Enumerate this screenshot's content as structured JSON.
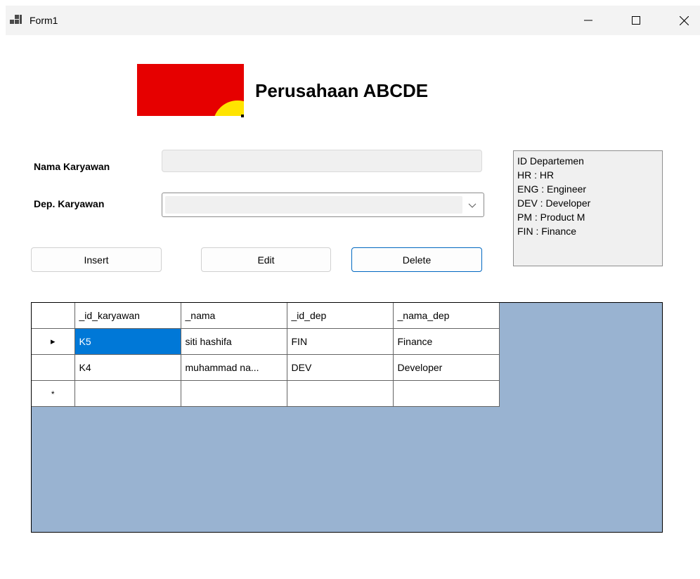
{
  "window": {
    "title": "Form1",
    "minimize_icon": "minimize-icon",
    "maximize_icon": "maximize-icon",
    "close_icon": "close-icon"
  },
  "header": {
    "logo": "company-logo",
    "company_name": "Perusahaan ABCDE"
  },
  "form": {
    "nama_label": "Nama Karyawan",
    "nama_value": "",
    "dep_label": "Dep. Karyawan",
    "dep_value": ""
  },
  "dept_info": {
    "lines": [
      "ID Departemen",
      "HR : HR",
      "ENG : Engineer",
      "DEV : Developer",
      "PM : Product M",
      "FIN : Finance"
    ]
  },
  "buttons": {
    "insert": "Insert",
    "edit": "Edit",
    "delete": "Delete"
  },
  "grid": {
    "columns": [
      "_id_karyawan",
      "_nama",
      "_id_dep",
      "_nama_dep"
    ],
    "rows": [
      {
        "marker": "▸",
        "cells": [
          "K5",
          "siti hashifa",
          "FIN",
          "Finance"
        ],
        "selected_col": 0
      },
      {
        "marker": "",
        "cells": [
          "K4",
          "muhammad na...",
          "DEV",
          "Developer"
        ]
      }
    ],
    "new_row_marker": "*",
    "colors": {
      "background": "#99b3d1",
      "selection": "#0078d7"
    }
  }
}
